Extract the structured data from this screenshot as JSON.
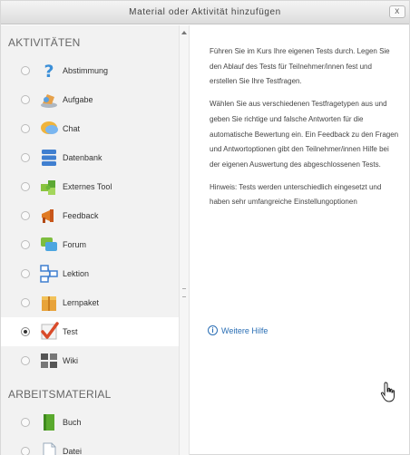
{
  "dialog": {
    "title": "Material oder Aktivität hinzufügen",
    "close_label": "x"
  },
  "sections": [
    {
      "heading": "AKTIVITÄTEN",
      "items": [
        {
          "label": "Abstimmung",
          "icon": "question-icon",
          "selected": false
        },
        {
          "label": "Aufgabe",
          "icon": "assignment-icon",
          "selected": false
        },
        {
          "label": "Chat",
          "icon": "chat-icon",
          "selected": false
        },
        {
          "label": "Datenbank",
          "icon": "database-icon",
          "selected": false
        },
        {
          "label": "Externes Tool",
          "icon": "puzzle-icon",
          "selected": false
        },
        {
          "label": "Feedback",
          "icon": "megaphone-icon",
          "selected": false
        },
        {
          "label": "Forum",
          "icon": "forum-icon",
          "selected": false
        },
        {
          "label": "Lektion",
          "icon": "lesson-icon",
          "selected": false
        },
        {
          "label": "Lernpaket",
          "icon": "package-icon",
          "selected": false
        },
        {
          "label": "Test",
          "icon": "checkmark-icon",
          "selected": true
        },
        {
          "label": "Wiki",
          "icon": "wiki-icon",
          "selected": false
        }
      ]
    },
    {
      "heading": "ARBEITSMATERIAL",
      "items": [
        {
          "label": "Buch",
          "icon": "book-icon",
          "selected": false
        },
        {
          "label": "Datei",
          "icon": "file-icon",
          "selected": false
        }
      ]
    }
  ],
  "help": {
    "paragraphs": [
      "Führen Sie im Kurs Ihre eigenen Tests durch. Legen Sie den Ablauf des Tests für Teilnehmer/innen fest und erstellen Sie Ihre Testfragen.",
      "Wählen Sie aus verschiedenen Testfragetypen aus und geben Sie richtige und falsche Antworten für die automatische Bewertung ein. Ein Feedback zu den Fragen und Antwortoptionen gibt den Teilnehmer/innen Hilfe bei der eigenen Auswertung des abgeschlossenen Tests.",
      "Hinweis: Tests werden unterschiedlich eingesetzt und haben sehr umfangreiche Einstellungoptionen"
    ],
    "more_link": "Weitere Hilfe"
  },
  "colors": {
    "accent": "#2b6fb5",
    "panel": "#f2f2f2"
  }
}
